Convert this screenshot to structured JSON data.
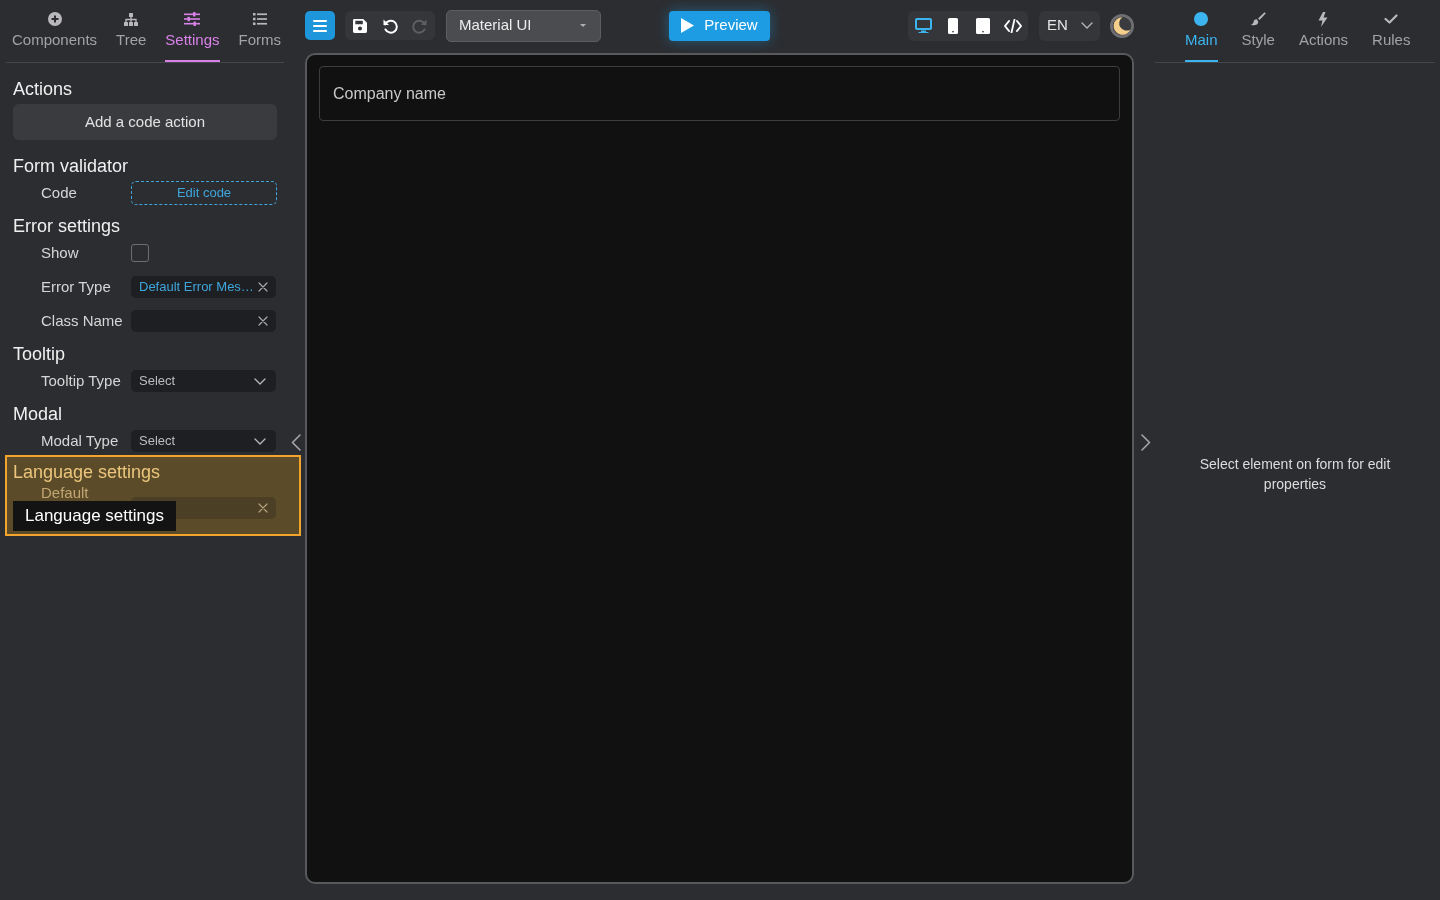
{
  "left_panel": {
    "tabs": [
      {
        "label": "Components",
        "selected": false
      },
      {
        "label": "Tree",
        "selected": false
      },
      {
        "label": "Settings",
        "selected": true
      },
      {
        "label": "Forms",
        "selected": false
      }
    ],
    "sections": [
      {
        "title": "Actions",
        "highlighted": false,
        "items": [
          {
            "kind": "button",
            "label": "Add a code action"
          }
        ]
      },
      {
        "title": "Form validator",
        "highlighted": false,
        "items": [
          {
            "kind": "code",
            "label": "Code",
            "button": "Edit code"
          }
        ]
      },
      {
        "title": "Error settings",
        "highlighted": false,
        "items": [
          {
            "kind": "checkbox",
            "label": "Show",
            "checked": false
          },
          {
            "kind": "field",
            "label": "Error Type",
            "value": "Default Error Mes…"
          },
          {
            "kind": "field",
            "label": "Class Name"
          }
        ]
      },
      {
        "title": "Tooltip",
        "highlighted": false,
        "items": [
          {
            "kind": "select",
            "label": "Tooltip Type",
            "placeholder": "Select"
          }
        ]
      },
      {
        "title": "Modal",
        "highlighted": false,
        "items": [
          {
            "kind": "select",
            "label": "Modal Type",
            "placeholder": "Select"
          }
        ]
      },
      {
        "title": "Language settings",
        "highlighted": true,
        "tooltip": "Language settings",
        "items": [
          {
            "kind": "field",
            "label": "Default"
          }
        ]
      }
    ]
  },
  "toolbar": {
    "history": [
      {
        "disabled": false
      },
      {
        "disabled": false
      },
      {
        "disabled": true
      }
    ],
    "library": "Material UI",
    "preview": "Preview",
    "devices": [
      {
        "selected": true
      },
      {
        "selected": false
      },
      {
        "selected": false
      },
      {
        "selected": false
      }
    ],
    "language": "EN"
  },
  "canvas": {
    "fields": [
      {
        "placeholder": "Company name"
      }
    ]
  },
  "right_panel": {
    "tabs": [
      {
        "label": "Main",
        "selected": true
      },
      {
        "label": "Style",
        "selected": false
      },
      {
        "label": "Actions",
        "selected": false
      },
      {
        "label": "Rules",
        "selected": false
      }
    ],
    "message": "Select element on form for edit properties"
  }
}
